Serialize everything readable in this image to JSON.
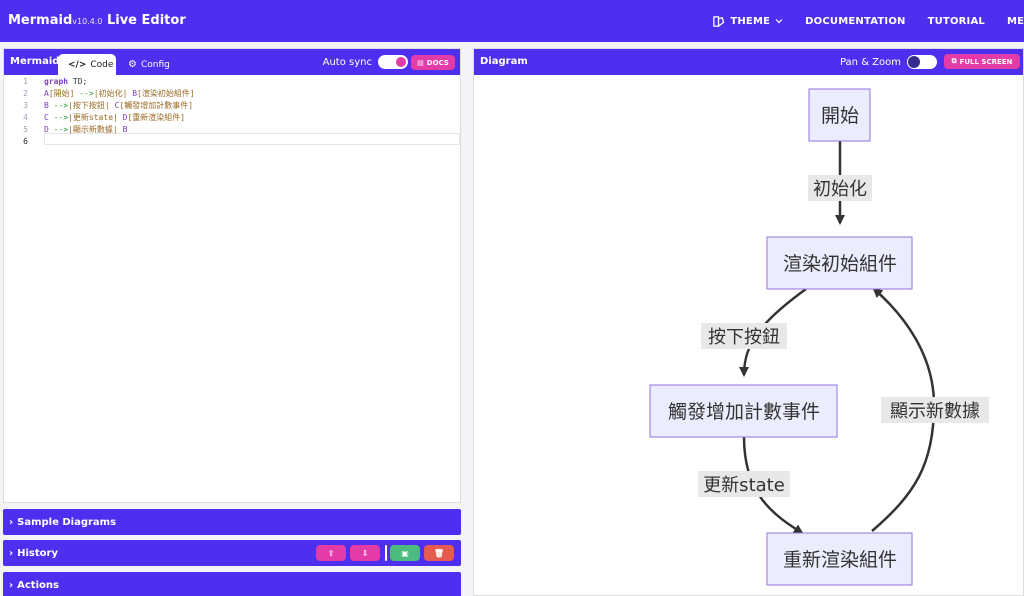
{
  "navbar": {
    "brand": "Mermaid",
    "version": "v10.4.0",
    "subtitle": "Live Editor",
    "links": [
      "THEME",
      "DOCUMENTATION",
      "TUTORIAL",
      "MER"
    ]
  },
  "editor_panel": {
    "title": "Mermaid",
    "tabs": [
      "Code",
      "Config"
    ],
    "auto_sync_label": "Auto sync",
    "docs_label": "DOCS",
    "lines": [
      {
        "n": "1",
        "tokens": [
          [
            "kw",
            "graph"
          ],
          [
            "txt",
            " TD;"
          ]
        ]
      },
      {
        "n": "2",
        "tokens": [
          [
            "id",
            "A"
          ],
          [
            "br",
            "[開始]"
          ],
          [
            "txt",
            " "
          ],
          [
            "arrow",
            "-->"
          ],
          [
            "br",
            "|初始化|"
          ],
          [
            "txt",
            " "
          ],
          [
            "id",
            "B"
          ],
          [
            "br",
            "[渲染初始組件]"
          ]
        ]
      },
      {
        "n": "3",
        "tokens": [
          [
            "id",
            "B"
          ],
          [
            "txt",
            " "
          ],
          [
            "arrow",
            "-->"
          ],
          [
            "br",
            "|按下按鈕|"
          ],
          [
            "txt",
            " "
          ],
          [
            "id",
            "C"
          ],
          [
            "br",
            "[觸發增加計數事件]"
          ]
        ]
      },
      {
        "n": "4",
        "tokens": [
          [
            "id",
            "C"
          ],
          [
            "txt",
            " "
          ],
          [
            "arrow",
            "-->"
          ],
          [
            "br",
            "|更新state|"
          ],
          [
            "txt",
            " "
          ],
          [
            "id",
            "D"
          ],
          [
            "br",
            "[重新渲染組件]"
          ]
        ]
      },
      {
        "n": "5",
        "tokens": [
          [
            "id",
            "D"
          ],
          [
            "txt",
            " "
          ],
          [
            "arrow",
            "-->"
          ],
          [
            "br",
            "|顯示新數據|"
          ],
          [
            "txt",
            " "
          ],
          [
            "id",
            "B"
          ]
        ]
      },
      {
        "n": "6",
        "tokens": []
      }
    ]
  },
  "sections": {
    "samples": "Sample Diagrams",
    "history": "History",
    "actions": "Actions"
  },
  "diagram_panel": {
    "title": "Diagram",
    "pan_zoom_label": "Pan & Zoom",
    "fullscreen_label": "FULL SCREEN",
    "nodes": {
      "A": "開始",
      "B": "渲染初始組件",
      "C": "觸發增加計數事件",
      "D": "重新渲染組件"
    },
    "edges": {
      "AB": "初始化",
      "BC": "按下按鈕",
      "CD": "更新state",
      "DB": "顯示新數據"
    }
  },
  "colors": {
    "brand": "#4e2ff0",
    "accent_pink": "#e33ba8",
    "green_button": "#4cbb7f",
    "red_button": "#e55b4f",
    "node_fill": "#ececff",
    "node_stroke": "#9370db"
  }
}
